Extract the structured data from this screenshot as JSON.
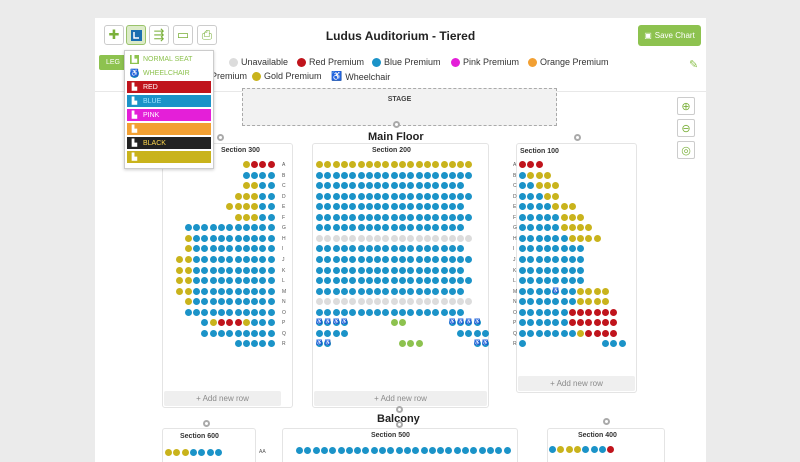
{
  "app": {
    "title": "Ludus Auditorium - Tiered",
    "save_label": "Save Chart",
    "legend_tab": "LEG",
    "toolbar_icons": [
      "add-icon",
      "select-icon",
      "row-tool-icon",
      "comment-icon",
      "print-icon"
    ]
  },
  "legend": {
    "items": [
      {
        "label": "ble",
        "color": ""
      },
      {
        "label": "Unavailable",
        "color": "#dcdcdc"
      },
      {
        "label": "Red Premium",
        "color": "#c0141c"
      },
      {
        "label": "Blue Premium",
        "color": "#1b93c8"
      },
      {
        "label": "Pink Premium",
        "color": "#e41fd8"
      },
      {
        "label": "Orange Premium",
        "color": "#f2a033"
      },
      {
        "label": "Premium",
        "color": ""
      },
      {
        "label": "Gold Premium",
        "color": "#c9b31c"
      },
      {
        "label": "Wheelchair",
        "color": ""
      }
    ]
  },
  "dropdown": {
    "items": [
      {
        "label": "NORMAL SEAT",
        "bg": "#ffffff",
        "fg": "#8dc24f"
      },
      {
        "label": "WHEELCHAIR",
        "bg": "#ffffff",
        "fg": "#8dc24f"
      },
      {
        "label": "RED",
        "bg": "#c0141c",
        "fg": "#ffffff"
      },
      {
        "label": "BLUE",
        "bg": "#1b93c8",
        "fg": "#9fe3ff"
      },
      {
        "label": "PINK",
        "bg": "#e41fd8",
        "fg": "#ffffff"
      },
      {
        "label": "ORANGE",
        "bg": "#f2a033",
        "fg": "#f2a033"
      },
      {
        "label": "BLACK",
        "bg": "#222222",
        "fg": "#ffd84d"
      },
      {
        "label": "GOLD",
        "bg": "#c9b31c",
        "fg": "#c9b31c"
      }
    ]
  },
  "stage_label": "STAGE",
  "levels": {
    "main_floor": "Main Floor",
    "balcony": "Balcony"
  },
  "sections": {
    "s300": "Section 300",
    "s200": "Section 200",
    "s100": "Section 100",
    "s600": "Section 600",
    "s500": "Section 500",
    "s400": "Section 400"
  },
  "add_row_label": "+ Add new row",
  "row_letters": [
    "A",
    "B",
    "C",
    "D",
    "E",
    "F",
    "G",
    "H",
    "I",
    "J",
    "K",
    "L",
    "M",
    "N",
    "O",
    "P",
    "Q",
    "R",
    "S",
    "T"
  ],
  "balcony_row_letter": "AA",
  "colors": {
    "blue": "#1b93c8",
    "gold": "#c9b31c",
    "red": "#c0141c",
    "gray": "#dcdcdc",
    "green": "#8dc24f",
    "accent": "#8dc24f"
  }
}
